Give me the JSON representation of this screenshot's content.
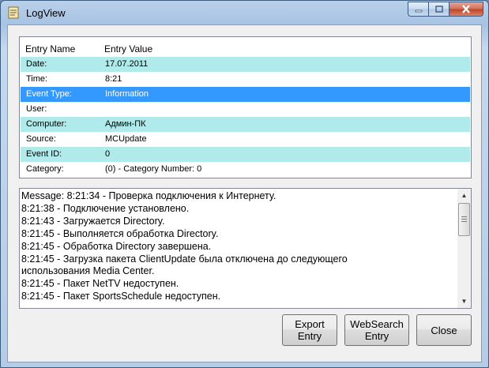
{
  "window": {
    "title": "LogView"
  },
  "grid": {
    "columns": {
      "name": "Entry Name",
      "value": "Entry Value"
    },
    "rows": [
      {
        "name": "Date:",
        "value": "17.07.2011"
      },
      {
        "name": "Time:",
        "value": "8:21"
      },
      {
        "name": "Event Type:",
        "value": "Information"
      },
      {
        "name": "User:",
        "value": ""
      },
      {
        "name": "Computer:",
        "value": "Админ-ПК"
      },
      {
        "name": "Source:",
        "value": "MCUpdate"
      },
      {
        "name": "Event ID:",
        "value": "0"
      },
      {
        "name": "Category:",
        "value": "(0) - Category Number: 0"
      }
    ],
    "selected_row": "Event Type:"
  },
  "message": {
    "lines": [
      "Message: 8:21:34 - Проверка подключения к Интернету.",
      "8:21:38 - Подключение установлено.",
      "8:21:43 - Загружается Directory.",
      "8:21:45 - Выполняется обработка Directory.",
      "8:21:45 - Обработка Directory завершена.",
      "8:21:45 - Загрузка пакета ClientUpdate была отключена до следующего",
      "использования Media Center.",
      "8:21:45 - Пакет NetTV недоступен.",
      "8:21:45 - Пакет SportsSchedule недоступен."
    ]
  },
  "buttons": {
    "export": "Export\nEntry",
    "websearch": "WebSearch\nEntry",
    "close": "Close"
  },
  "icons": {
    "app": "log-document-icon",
    "minimize": "minimize-icon",
    "maximize": "maximize-icon",
    "close": "close-icon",
    "scroll_up": "scroll-up-arrow-icon",
    "scroll_down": "scroll-down-arrow-icon"
  },
  "colors": {
    "alt_row": "#b0eaea",
    "selected_row": "#3399ff",
    "close_button": "#c2462a"
  }
}
